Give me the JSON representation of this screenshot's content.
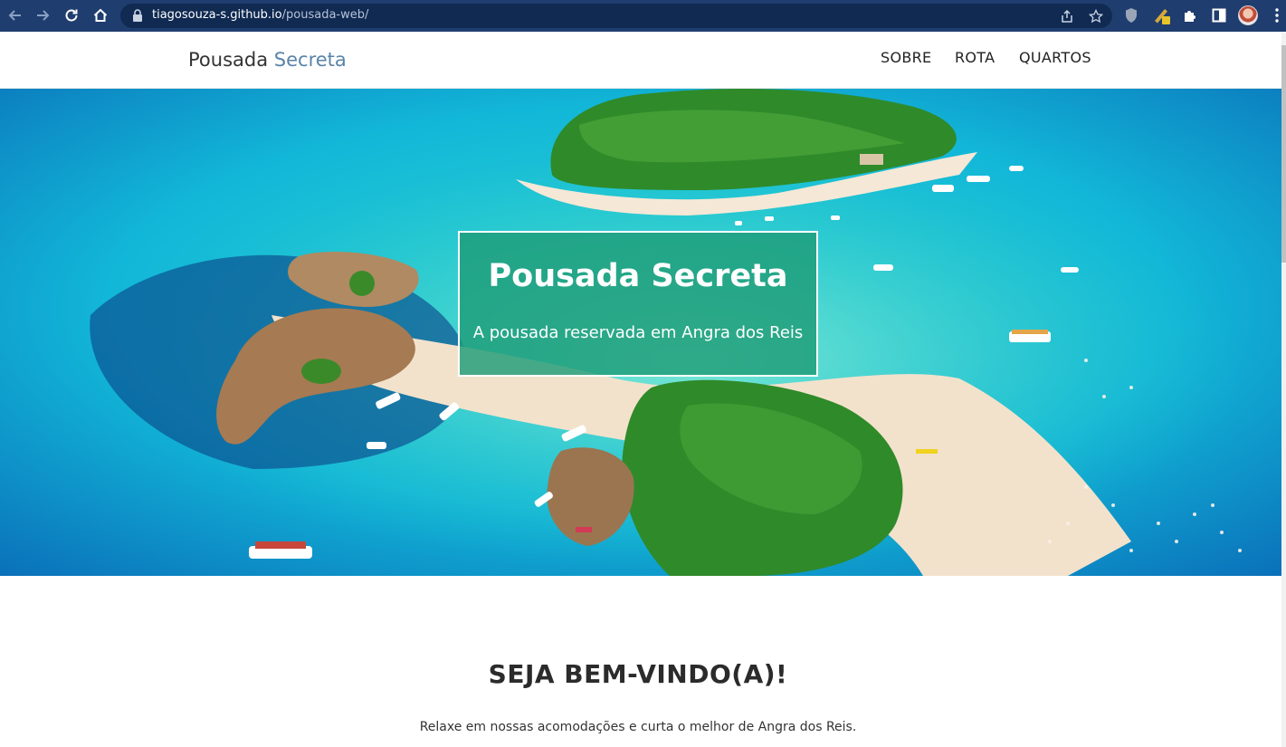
{
  "browser": {
    "url_domain": "tiagosouza-s.github.io",
    "url_path": "/pousada-web/",
    "icons": [
      "back-icon",
      "forward-icon",
      "reload-icon",
      "home-icon",
      "lock-icon",
      "share-icon",
      "star-icon",
      "shield-extension-icon",
      "pencil-extension-icon",
      "puzzle-icon",
      "sidepanel-icon",
      "avatar",
      "kebab-menu-icon"
    ]
  },
  "site": {
    "brand_first": "Pousada",
    "brand_second": "Secreta",
    "menu": [
      {
        "label": "SOBRE"
      },
      {
        "label": "ROTA"
      },
      {
        "label": "QUARTOS"
      }
    ]
  },
  "hero": {
    "title": "Pousada Secreta",
    "subtitle": "A pousada reservada em Angra dos Reis",
    "box_color": "#1f9c78"
  },
  "welcome": {
    "title": "SEJA BEM-VINDO(A)!",
    "text": "Relaxe em nossas acomodações e curta o melhor de Angra dos Reis."
  },
  "colors": {
    "chrome_bg": "#1f3d6e",
    "omnibox_bg": "#102a52",
    "brand_accent": "#5a84a8"
  }
}
